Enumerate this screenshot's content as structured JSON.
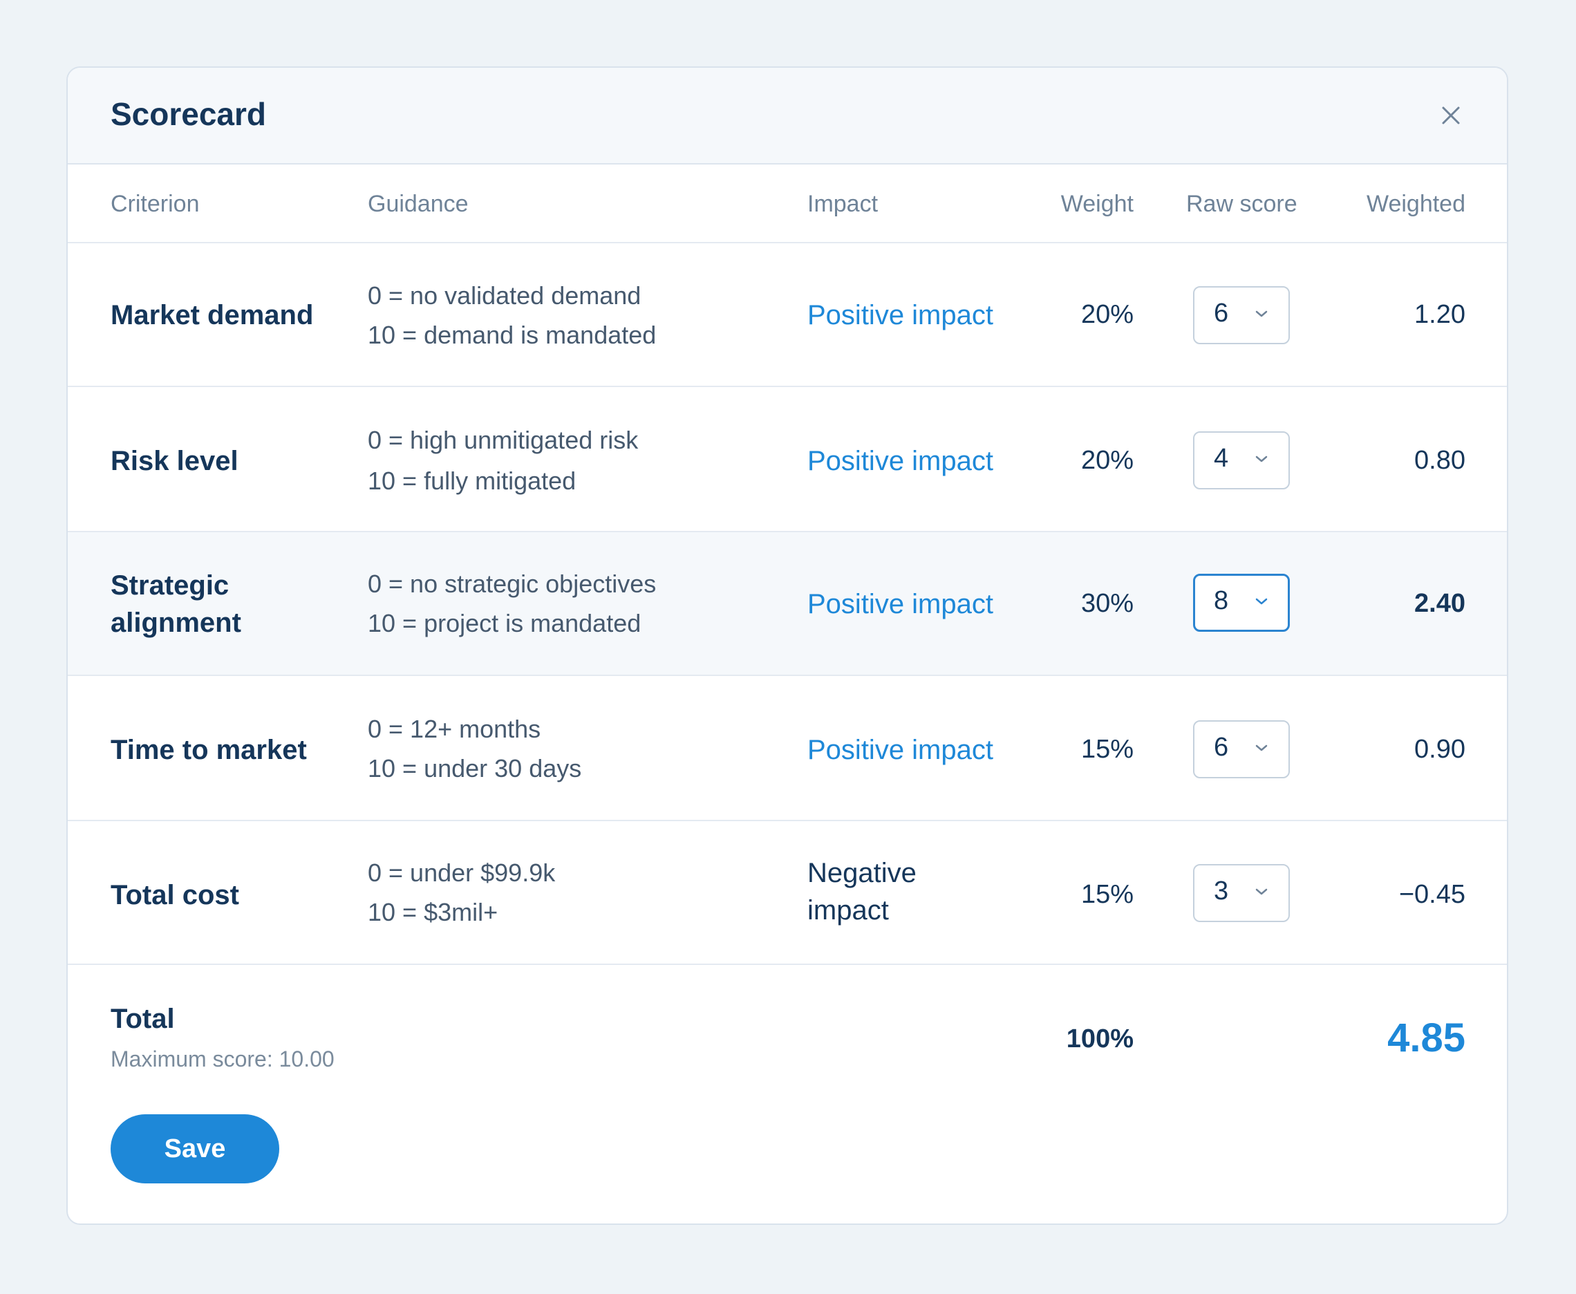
{
  "dialog": {
    "title": "Scorecard",
    "close_icon": "close-icon"
  },
  "columns": {
    "criterion": "Criterion",
    "guidance": "Guidance",
    "impact": "Impact",
    "weight": "Weight",
    "raw_score": "Raw score",
    "weighted": "Weighted"
  },
  "rows": [
    {
      "criterion": "Market demand",
      "guidance_low": "0 = no validated demand",
      "guidance_high": "10 = demand is mandated",
      "impact": "Positive impact",
      "weight": "20%",
      "raw_score": "6",
      "weighted": "1.20"
    },
    {
      "criterion": "Risk level",
      "guidance_low": "0 = high unmitigated risk",
      "guidance_high": "10 = fully mitigated",
      "impact": "Positive impact",
      "weight": "20%",
      "raw_score": "4",
      "weighted": "0.80"
    },
    {
      "criterion": "Strategic alignment",
      "guidance_low": "0 = no strategic objectives",
      "guidance_high": "10 = project is mandated",
      "impact": "Positive impact",
      "weight": "30%",
      "raw_score": "8",
      "weighted": "2.40"
    },
    {
      "criterion": "Time to market",
      "guidance_low": "0 = 12+ months",
      "guidance_high": "10 = under 30 days",
      "impact": "Positive impact",
      "weight": "15%",
      "raw_score": "6",
      "weighted": "0.90"
    },
    {
      "criterion": "Total cost",
      "guidance_low": "0 = under $99.9k",
      "guidance_high": "10 = $3mil+",
      "impact": "Negative impact",
      "weight": "15%",
      "raw_score": "3",
      "weighted": "−0.45"
    }
  ],
  "total": {
    "label": "Total",
    "max_score": "Maximum score: 10.00",
    "weight": "100%",
    "score": "4.85"
  },
  "actions": {
    "save_label": "Save"
  },
  "colors": {
    "accent": "#1e88d8",
    "text_dark": "#15365a",
    "muted": "#6f8398",
    "background": "#eef3f7"
  }
}
